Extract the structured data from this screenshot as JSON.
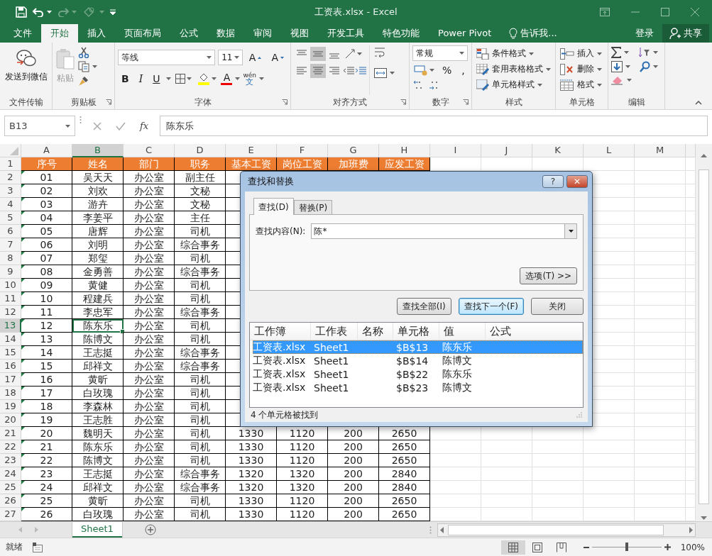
{
  "window": {
    "title": "工资表.xlsx - Excel"
  },
  "ribbon_tabs": [
    {
      "label": "文件",
      "selected": false
    },
    {
      "label": "开始",
      "selected": true
    },
    {
      "label": "插入",
      "selected": false
    },
    {
      "label": "页面布局",
      "selected": false
    },
    {
      "label": "公式",
      "selected": false
    },
    {
      "label": "数据",
      "selected": false
    },
    {
      "label": "审阅",
      "selected": false
    },
    {
      "label": "视图",
      "selected": false
    },
    {
      "label": "开发工具",
      "selected": false
    },
    {
      "label": "特色功能",
      "selected": false
    },
    {
      "label": "Power Pivot",
      "selected": false
    }
  ],
  "tell_me": "告诉我...",
  "sign_in": "登录",
  "share": "共享",
  "ribbon": {
    "wechat": {
      "label": "发送到微信",
      "group": "文件传输"
    },
    "clipboard": {
      "paste": "粘贴",
      "paste_disabled": true,
      "group": "剪贴板"
    },
    "font": {
      "name": "等线",
      "size": "11",
      "grow": "A",
      "shrink": "A",
      "bold": "B",
      "italic": "I",
      "underline": "U",
      "color_letter": "A",
      "phonetic_top": "wén",
      "phonetic_bottom": "文",
      "group": "字体"
    },
    "alignment": {
      "vertical": [
        {
          "on": false
        },
        {
          "on": true
        },
        {
          "on": false
        }
      ],
      "horizontal": [
        {
          "on": false
        },
        {
          "on": true
        },
        {
          "on": false
        }
      ],
      "group": "对齐方式"
    },
    "number": {
      "format": "常规",
      "percent": "%",
      "comma": ",",
      "group": "数字"
    },
    "styles": {
      "items": [
        "条件格式",
        "套用表格格式",
        "单元格样式"
      ],
      "group": "样式"
    },
    "cells": {
      "items": [
        "插入",
        "删除",
        "格式"
      ],
      "group": "单元格"
    },
    "editing": {
      "group": "编辑"
    }
  },
  "formula_bar": {
    "name_box": "B13",
    "fx": "fx",
    "value": "陈东乐"
  },
  "grid": {
    "columns": [
      {
        "label": "A",
        "selected": false
      },
      {
        "label": "B",
        "selected": true
      },
      {
        "label": "C",
        "selected": false
      },
      {
        "label": "D",
        "selected": false
      },
      {
        "label": "E",
        "selected": false
      },
      {
        "label": "F",
        "selected": false
      },
      {
        "label": "G",
        "selected": false
      },
      {
        "label": "H",
        "selected": false
      },
      {
        "label": "I",
        "selected": false
      },
      {
        "label": "J",
        "selected": false
      },
      {
        "label": "K",
        "selected": false
      },
      {
        "label": "L",
        "selected": false
      },
      {
        "label": "M",
        "selected": false
      }
    ],
    "rows": [
      {
        "label": "1",
        "kind": "header",
        "selected": false,
        "cells": [
          "序号",
          "姓名",
          "部门",
          "职务",
          "基本工资",
          "岗位工资",
          "加班费",
          "应发工资"
        ]
      },
      {
        "label": "2",
        "kind": "data",
        "selected": false,
        "cells": [
          "01",
          "吴天天",
          "办公室",
          "副主任"
        ]
      },
      {
        "label": "3",
        "kind": "data",
        "selected": false,
        "cells": [
          "02",
          "刘欢",
          "办公室",
          "文秘"
        ]
      },
      {
        "label": "4",
        "kind": "data",
        "selected": false,
        "cells": [
          "03",
          "游卉",
          "办公室",
          "文秘"
        ]
      },
      {
        "label": "5",
        "kind": "data",
        "selected": false,
        "cells": [
          "04",
          "李姜平",
          "办公室",
          "主任"
        ]
      },
      {
        "label": "6",
        "kind": "data",
        "selected": false,
        "cells": [
          "05",
          "唐辉",
          "办公室",
          "司机"
        ]
      },
      {
        "label": "7",
        "kind": "data",
        "selected": false,
        "cells": [
          "06",
          "刘明",
          "办公室",
          "综合事务"
        ]
      },
      {
        "label": "8",
        "kind": "data",
        "selected": false,
        "cells": [
          "07",
          "郑玺",
          "办公室",
          "司机"
        ]
      },
      {
        "label": "9",
        "kind": "data",
        "selected": false,
        "cells": [
          "08",
          "金勇善",
          "办公室",
          "综合事务"
        ]
      },
      {
        "label": "10",
        "kind": "data",
        "selected": false,
        "cells": [
          "09",
          "黄健",
          "办公室",
          "司机"
        ]
      },
      {
        "label": "11",
        "kind": "data",
        "selected": false,
        "cells": [
          "10",
          "程建兵",
          "办公室",
          "司机"
        ]
      },
      {
        "label": "12",
        "kind": "data",
        "selected": false,
        "cells": [
          "11",
          "李忠军",
          "办公室",
          "综合事务"
        ]
      },
      {
        "label": "13",
        "kind": "data",
        "selected": true,
        "cells": [
          "12",
          "陈东乐",
          "办公室",
          "司机"
        ]
      },
      {
        "label": "14",
        "kind": "data",
        "selected": false,
        "cells": [
          "13",
          "陈博文",
          "办公室",
          "司机"
        ]
      },
      {
        "label": "15",
        "kind": "data",
        "selected": false,
        "cells": [
          "14",
          "王志挺",
          "办公室",
          "综合事务"
        ]
      },
      {
        "label": "16",
        "kind": "data",
        "selected": false,
        "cells": [
          "15",
          "邱祥文",
          "办公室",
          "综合事务"
        ]
      },
      {
        "label": "17",
        "kind": "data",
        "selected": false,
        "cells": [
          "16",
          "黄昕",
          "办公室",
          "司机"
        ]
      },
      {
        "label": "18",
        "kind": "data",
        "selected": false,
        "cells": [
          "17",
          "白玫瑰",
          "办公室",
          "司机"
        ]
      },
      {
        "label": "19",
        "kind": "data",
        "selected": false,
        "cells": [
          "18",
          "李森林",
          "办公室",
          "司机"
        ]
      },
      {
        "label": "20",
        "kind": "data",
        "selected": false,
        "cells": [
          "19",
          "王志胜",
          "办公室",
          "司机"
        ]
      },
      {
        "label": "21",
        "kind": "data",
        "selected": false,
        "cells": [
          "20",
          "魏明天",
          "办公室",
          "司机",
          "1330",
          "1120",
          "200",
          "2650"
        ]
      },
      {
        "label": "22",
        "kind": "data",
        "selected": false,
        "cells": [
          "21",
          "陈东乐",
          "办公室",
          "司机",
          "1330",
          "1120",
          "200",
          "2650"
        ]
      },
      {
        "label": "23",
        "kind": "data",
        "selected": false,
        "cells": [
          "22",
          "陈博文",
          "办公室",
          "司机",
          "1330",
          "1120",
          "200",
          "2650"
        ]
      },
      {
        "label": "24",
        "kind": "data",
        "selected": false,
        "cells": [
          "23",
          "王志挺",
          "办公室",
          "综合事务",
          "1320",
          "1320",
          "200",
          "2840"
        ]
      },
      {
        "label": "25",
        "kind": "data",
        "selected": false,
        "cells": [
          "24",
          "邱祥文",
          "办公室",
          "综合事务",
          "1320",
          "1320",
          "200",
          "2840"
        ]
      },
      {
        "label": "26",
        "kind": "data",
        "selected": false,
        "cells": [
          "25",
          "黄昕",
          "办公室",
          "司机",
          "1330",
          "1120",
          "200",
          "2650"
        ]
      },
      {
        "label": "27",
        "kind": "data",
        "selected": false,
        "cells": [
          "26",
          "白玫瑰",
          "办公室",
          "司机",
          "1330",
          "1120",
          "200",
          "2650"
        ]
      }
    ]
  },
  "dialog": {
    "title": "查找和替换",
    "help": "?",
    "close": "✕",
    "tabs": [
      {
        "label": "查找(D)",
        "selected": true
      },
      {
        "label": "替换(P)",
        "selected": false
      }
    ],
    "find_label": "查找内容(N):",
    "find_value": "陈*",
    "options": "选项(T) >>",
    "buttons": [
      {
        "label": "查找全部(I)",
        "focused": false
      },
      {
        "label": "查找下一个(F)",
        "focused": true
      },
      {
        "label": "关闭",
        "focused": false
      }
    ],
    "results": {
      "columns": [
        "工作簿",
        "工作表",
        "名称",
        "单元格",
        "值",
        "公式"
      ],
      "rows": [
        {
          "cells": [
            "工资表.xlsx",
            "Sheet1",
            "",
            "$B$13",
            "陈东乐",
            ""
          ],
          "selected": true
        },
        {
          "cells": [
            "工资表.xlsx",
            "Sheet1",
            "",
            "$B$14",
            "陈博文",
            ""
          ],
          "selected": false
        },
        {
          "cells": [
            "工资表.xlsx",
            "Sheet1",
            "",
            "$B$22",
            "陈东乐",
            ""
          ],
          "selected": false
        },
        {
          "cells": [
            "工资表.xlsx",
            "Sheet1",
            "",
            "$B$23",
            "陈博文",
            ""
          ],
          "selected": false
        }
      ]
    },
    "status": "4 个单元格被找到"
  },
  "sheet_tabs": [
    {
      "label": "Sheet1",
      "selected": true
    }
  ],
  "status_bar": {
    "text": "就绪",
    "zoom": "100%",
    "zoom_slider": {
      "level": 0.5
    }
  }
}
